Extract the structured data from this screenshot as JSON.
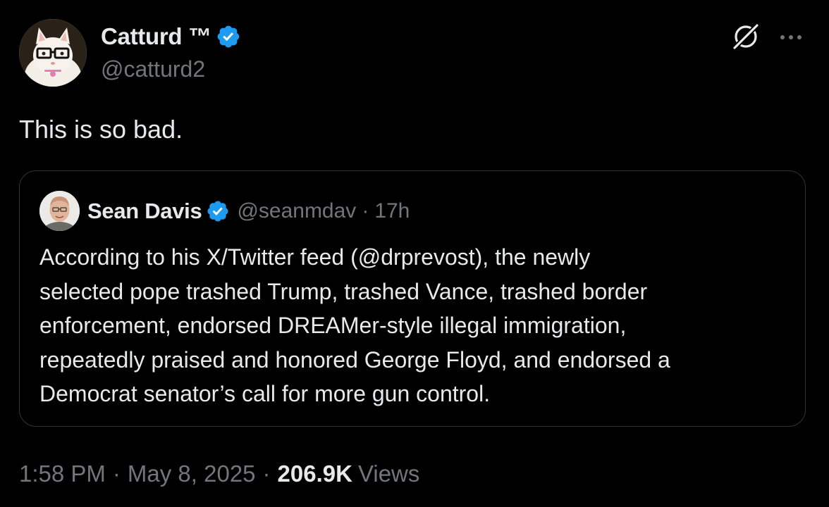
{
  "author": {
    "display_name": "Catturd ™",
    "handle": "@catturd2",
    "avatar_icon": "cat-with-glasses-avatar",
    "verified_icon": "verified-badge-icon"
  },
  "colors": {
    "background": "#000000",
    "text_primary": "#e7e9ea",
    "text_secondary": "#71767b",
    "verified_blue": "#1d9bf0",
    "border": "#2f3336"
  },
  "actions": {
    "grok_icon": "grok-icon",
    "more_icon": "more-options-icon"
  },
  "tweet": {
    "text": "This is so bad."
  },
  "quoted": {
    "display_name": "Sean Davis",
    "handle": "@seanmdav",
    "separator": "·",
    "time": "17h",
    "text_lines": [
      "According to his X/Twitter feed (@drprevost), the newly",
      "selected pope trashed Trump, trashed Vance, trashed border",
      "enforcement, endorsed DREAMer-style illegal immigration,",
      "repeatedly praised and honored George Floyd, and endorsed a",
      "Democrat senator’s call for more gun control."
    ]
  },
  "meta": {
    "time": "1:58 PM",
    "separator": "·",
    "date": "May 8, 2025",
    "views_count": "206.9K",
    "views_label": "Views"
  }
}
